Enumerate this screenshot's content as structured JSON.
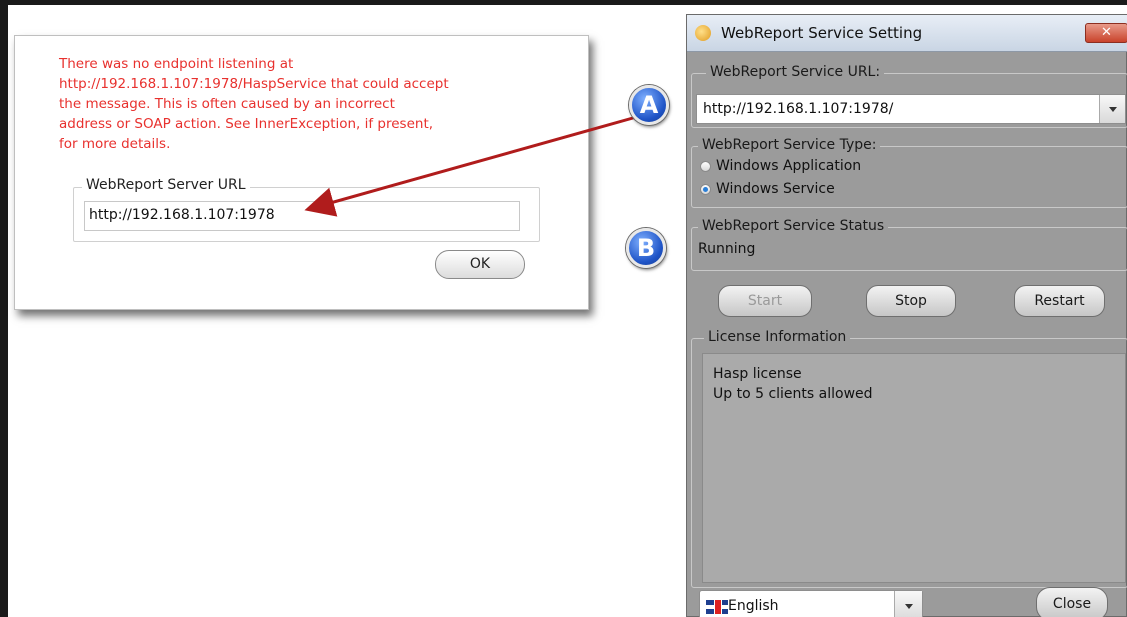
{
  "error_dialog": {
    "message_lines": [
      "There was no endpoint listening at",
      "http://192.168.1.107:1978/HaspService that could accept",
      "the message. This is often caused by an incorrect",
      "address or SOAP action. See InnerException, if present,",
      "for more details."
    ],
    "group_label": "WebReport Server URL",
    "url_value": "http://192.168.1.107:1978",
    "ok_label": "OK"
  },
  "window": {
    "title": "WebReport Service Setting",
    "close_glyph": "✕",
    "url_group_label": "WebReport Service URL:",
    "url_value": "http://192.168.1.107:1978/",
    "type_group_label": "WebReport Service Type:",
    "type_options": [
      {
        "label": "Windows Application",
        "selected": false
      },
      {
        "label": "Windows Service",
        "selected": true
      }
    ],
    "status_group_label": "WebReport Service Status",
    "status_value": "Running",
    "buttons": {
      "start": "Start",
      "stop": "Stop",
      "restart": "Restart",
      "close": "Close"
    },
    "license_group_label": "License Information",
    "license_lines": [
      "Hasp license",
      "Up to 5 clients allowed"
    ],
    "language": "English"
  },
  "callouts": {
    "a": "A",
    "b": "B"
  },
  "colors": {
    "error_text": "#e8312e",
    "arrow": "#b01c1c",
    "callout": "#1f54c7",
    "window_bg": "#9b9b9b"
  }
}
